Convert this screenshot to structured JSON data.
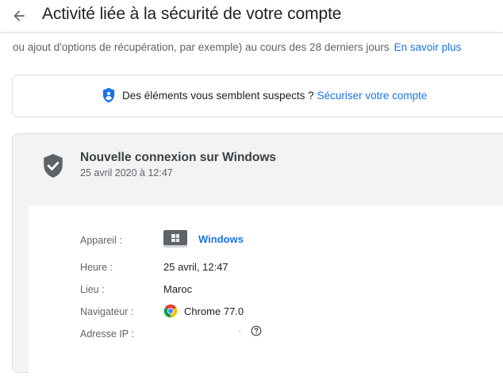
{
  "header": {
    "title": "Activité liée à la sécurité de votre compte"
  },
  "intro": {
    "text": "ou ajout d'options de récupération, par exemple) au cours des 28 derniers jours",
    "learn_more": "En savoir plus"
  },
  "suspect": {
    "text": "Des éléments vous semblent suspects ?",
    "link": "Sécuriser votre compte"
  },
  "event": {
    "title": "Nouvelle connexion sur Windows",
    "date": "25 avril 2020 à 12:47",
    "details": {
      "device_label": "Appareil :",
      "device_value": "Windows",
      "time_label": "Heure :",
      "time_value": "25 avril, 12:47",
      "location_label": "Lieu :",
      "location_value": "Maroc",
      "browser_label": "Navigateur :",
      "browser_value": "Chrome 77.0",
      "ip_label": "Adresse IP :",
      "ip_value": "·"
    }
  },
  "colors": {
    "accent": "#1a73e8",
    "icon_gray": "#5f6368",
    "card_bg": "#f1f3f4"
  },
  "icons": [
    "arrow-back-icon",
    "shield-icon",
    "shield-check-icon",
    "windows-device-icon",
    "chrome-icon",
    "help-icon"
  ]
}
